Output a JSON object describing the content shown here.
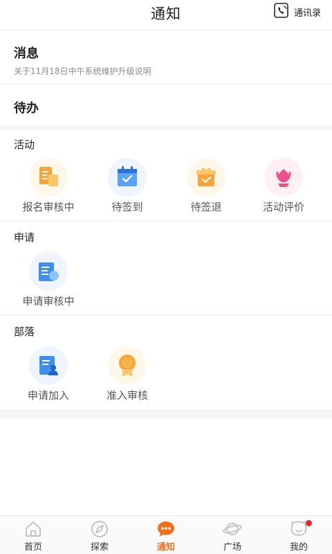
{
  "header": {
    "title": "通知",
    "contacts_label": "通讯录"
  },
  "messages": {
    "title": "消息",
    "subtitle": "关于11月18日中午系统维护升级说明"
  },
  "todo": {
    "title": "待办"
  },
  "activity": {
    "title": "活动",
    "items": [
      {
        "label": "报名审核中",
        "icon": "signup-review-icon"
      },
      {
        "label": "待签到",
        "icon": "calendar-check-icon"
      },
      {
        "label": "待签退",
        "icon": "gift-box-check-icon"
      },
      {
        "label": "活动评价",
        "icon": "flower-icon"
      }
    ]
  },
  "application": {
    "title": "申请",
    "items": [
      {
        "label": "申请审核中",
        "icon": "document-review-icon"
      }
    ]
  },
  "tribe": {
    "title": "部落",
    "items": [
      {
        "label": "申请加入",
        "icon": "join-document-icon"
      },
      {
        "label": "准入审核",
        "icon": "medal-icon"
      }
    ]
  },
  "bottom_nav": {
    "items": [
      {
        "label": "首页",
        "icon": "home-icon",
        "active": false
      },
      {
        "label": "探索",
        "icon": "compass-icon",
        "active": false
      },
      {
        "label": "通知",
        "icon": "chat-bubble-icon",
        "active": true
      },
      {
        "label": "广场",
        "icon": "planet-icon",
        "active": false
      },
      {
        "label": "我的",
        "icon": "profile-face-icon",
        "active": false,
        "badge": true
      }
    ]
  },
  "colors": {
    "accent": "#f07020",
    "badge": "#e8252b",
    "orange_icon": "#f7a53a",
    "blue_icon": "#3f8ef0",
    "pink_icon": "#ef4f8a"
  }
}
